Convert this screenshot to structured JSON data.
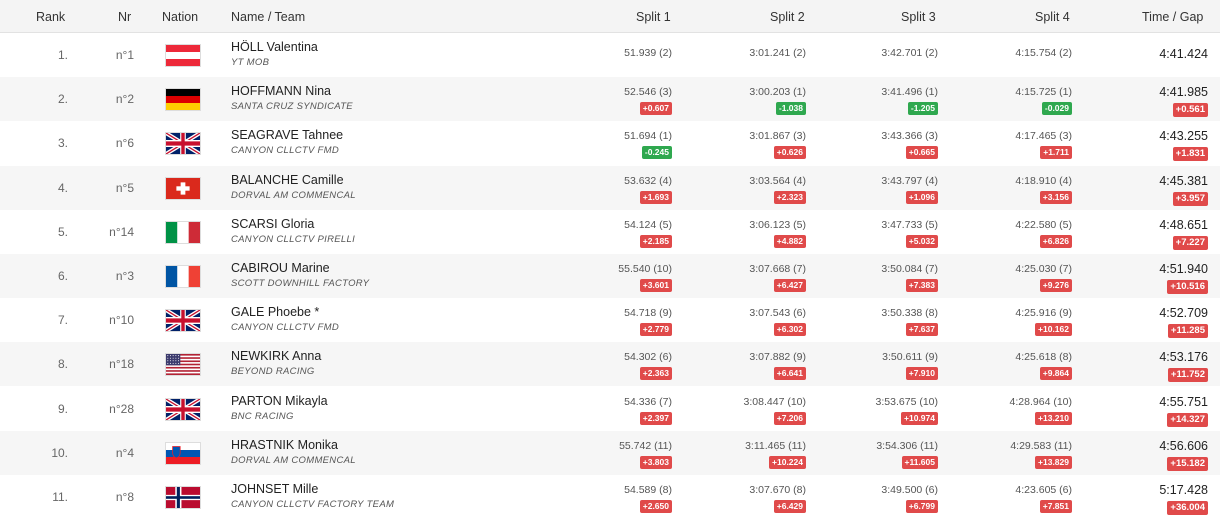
{
  "headers": {
    "rank": "Rank",
    "nr": "Nr",
    "nation": "Nation",
    "name_team": "Name / Team",
    "split1": "Split 1",
    "split2": "Split 2",
    "split3": "Split 3",
    "split4": "Split 4",
    "time_gap": "Time / Gap"
  },
  "rows": [
    {
      "rank": "1.",
      "nr": "n°1",
      "flag": "AUT",
      "name": "HÖLL Valentina",
      "team": "YT MOB",
      "splits": [
        {
          "t": "51.939 (2)",
          "g": ""
        },
        {
          "t": "3:01.241 (2)",
          "g": ""
        },
        {
          "t": "3:42.701 (2)",
          "g": ""
        },
        {
          "t": "4:15.754 (2)",
          "g": ""
        }
      ],
      "time": "4:41.424",
      "gap": ""
    },
    {
      "rank": "2.",
      "nr": "n°2",
      "flag": "GER",
      "name": "HOFFMANN Nina",
      "team": "SANTA CRUZ SYNDICATE",
      "splits": [
        {
          "t": "52.546 (3)",
          "g": "+0.607"
        },
        {
          "t": "3:00.203 (1)",
          "g": "-1.038"
        },
        {
          "t": "3:41.496 (1)",
          "g": "-1.205"
        },
        {
          "t": "4:15.725 (1)",
          "g": "-0.029"
        }
      ],
      "time": "4:41.985",
      "gap": "+0.561"
    },
    {
      "rank": "3.",
      "nr": "n°6",
      "flag": "GBR",
      "name": "SEAGRAVE Tahnee",
      "team": "CANYON CLLCTV FMD",
      "splits": [
        {
          "t": "51.694 (1)",
          "g": "-0.245"
        },
        {
          "t": "3:01.867 (3)",
          "g": "+0.626"
        },
        {
          "t": "3:43.366 (3)",
          "g": "+0.665"
        },
        {
          "t": "4:17.465 (3)",
          "g": "+1.711"
        }
      ],
      "time": "4:43.255",
      "gap": "+1.831"
    },
    {
      "rank": "4.",
      "nr": "n°5",
      "flag": "SUI",
      "name": "BALANCHE Camille",
      "team": "DORVAL AM COMMENCAL",
      "splits": [
        {
          "t": "53.632 (4)",
          "g": "+1.693"
        },
        {
          "t": "3:03.564 (4)",
          "g": "+2.323"
        },
        {
          "t": "3:43.797 (4)",
          "g": "+1.096"
        },
        {
          "t": "4:18.910 (4)",
          "g": "+3.156"
        }
      ],
      "time": "4:45.381",
      "gap": "+3.957"
    },
    {
      "rank": "5.",
      "nr": "n°14",
      "flag": "ITA",
      "name": "SCARSI Gloria",
      "team": "CANYON CLLCTV PIRELLI",
      "splits": [
        {
          "t": "54.124 (5)",
          "g": "+2.185"
        },
        {
          "t": "3:06.123 (5)",
          "g": "+4.882"
        },
        {
          "t": "3:47.733 (5)",
          "g": "+5.032"
        },
        {
          "t": "4:22.580 (5)",
          "g": "+6.826"
        }
      ],
      "time": "4:48.651",
      "gap": "+7.227"
    },
    {
      "rank": "6.",
      "nr": "n°3",
      "flag": "FRA",
      "name": "CABIROU Marine",
      "team": "SCOTT DOWNHILL FACTORY",
      "splits": [
        {
          "t": "55.540 (10)",
          "g": "+3.601"
        },
        {
          "t": "3:07.668 (7)",
          "g": "+6.427"
        },
        {
          "t": "3:50.084 (7)",
          "g": "+7.383"
        },
        {
          "t": "4:25.030 (7)",
          "g": "+9.276"
        }
      ],
      "time": "4:51.940",
      "gap": "+10.516"
    },
    {
      "rank": "7.",
      "nr": "n°10",
      "flag": "GBR",
      "name": "GALE Phoebe *",
      "team": "CANYON CLLCTV FMD",
      "splits": [
        {
          "t": "54.718 (9)",
          "g": "+2.779"
        },
        {
          "t": "3:07.543 (6)",
          "g": "+6.302"
        },
        {
          "t": "3:50.338 (8)",
          "g": "+7.637"
        },
        {
          "t": "4:25.916 (9)",
          "g": "+10.162"
        }
      ],
      "time": "4:52.709",
      "gap": "+11.285"
    },
    {
      "rank": "8.",
      "nr": "n°18",
      "flag": "USA",
      "name": "NEWKIRK Anna",
      "team": "BEYOND RACING",
      "splits": [
        {
          "t": "54.302 (6)",
          "g": "+2.363"
        },
        {
          "t": "3:07.882 (9)",
          "g": "+6.641"
        },
        {
          "t": "3:50.611 (9)",
          "g": "+7.910"
        },
        {
          "t": "4:25.618 (8)",
          "g": "+9.864"
        }
      ],
      "time": "4:53.176",
      "gap": "+11.752"
    },
    {
      "rank": "9.",
      "nr": "n°28",
      "flag": "GBR",
      "name": "PARTON Mikayla",
      "team": "BNC RACING",
      "splits": [
        {
          "t": "54.336 (7)",
          "g": "+2.397"
        },
        {
          "t": "3:08.447 (10)",
          "g": "+7.206"
        },
        {
          "t": "3:53.675 (10)",
          "g": "+10.974"
        },
        {
          "t": "4:28.964 (10)",
          "g": "+13.210"
        }
      ],
      "time": "4:55.751",
      "gap": "+14.327"
    },
    {
      "rank": "10.",
      "nr": "n°4",
      "flag": "SLO",
      "name": "HRASTNIK Monika",
      "team": "DORVAL AM COMMENCAL",
      "splits": [
        {
          "t": "55.742 (11)",
          "g": "+3.803"
        },
        {
          "t": "3:11.465 (11)",
          "g": "+10.224"
        },
        {
          "t": "3:54.306 (11)",
          "g": "+11.605"
        },
        {
          "t": "4:29.583 (11)",
          "g": "+13.829"
        }
      ],
      "time": "4:56.606",
      "gap": "+15.182"
    },
    {
      "rank": "11.",
      "nr": "n°8",
      "flag": "NOR",
      "name": "JOHNSET Mille",
      "team": "CANYON CLLCTV FACTORY TEAM",
      "splits": [
        {
          "t": "54.589 (8)",
          "g": "+2.650"
        },
        {
          "t": "3:07.670 (8)",
          "g": "+6.429"
        },
        {
          "t": "3:49.500 (6)",
          "g": "+6.799"
        },
        {
          "t": "4:23.605 (6)",
          "g": "+7.851"
        }
      ],
      "time": "5:17.428",
      "gap": "+36.004"
    }
  ],
  "colors": {
    "gap_positive": "#e04a4a",
    "gap_negative": "#2fa84f",
    "row_alt": "#f6f6f6",
    "header_bg": "#f4f4f4"
  }
}
